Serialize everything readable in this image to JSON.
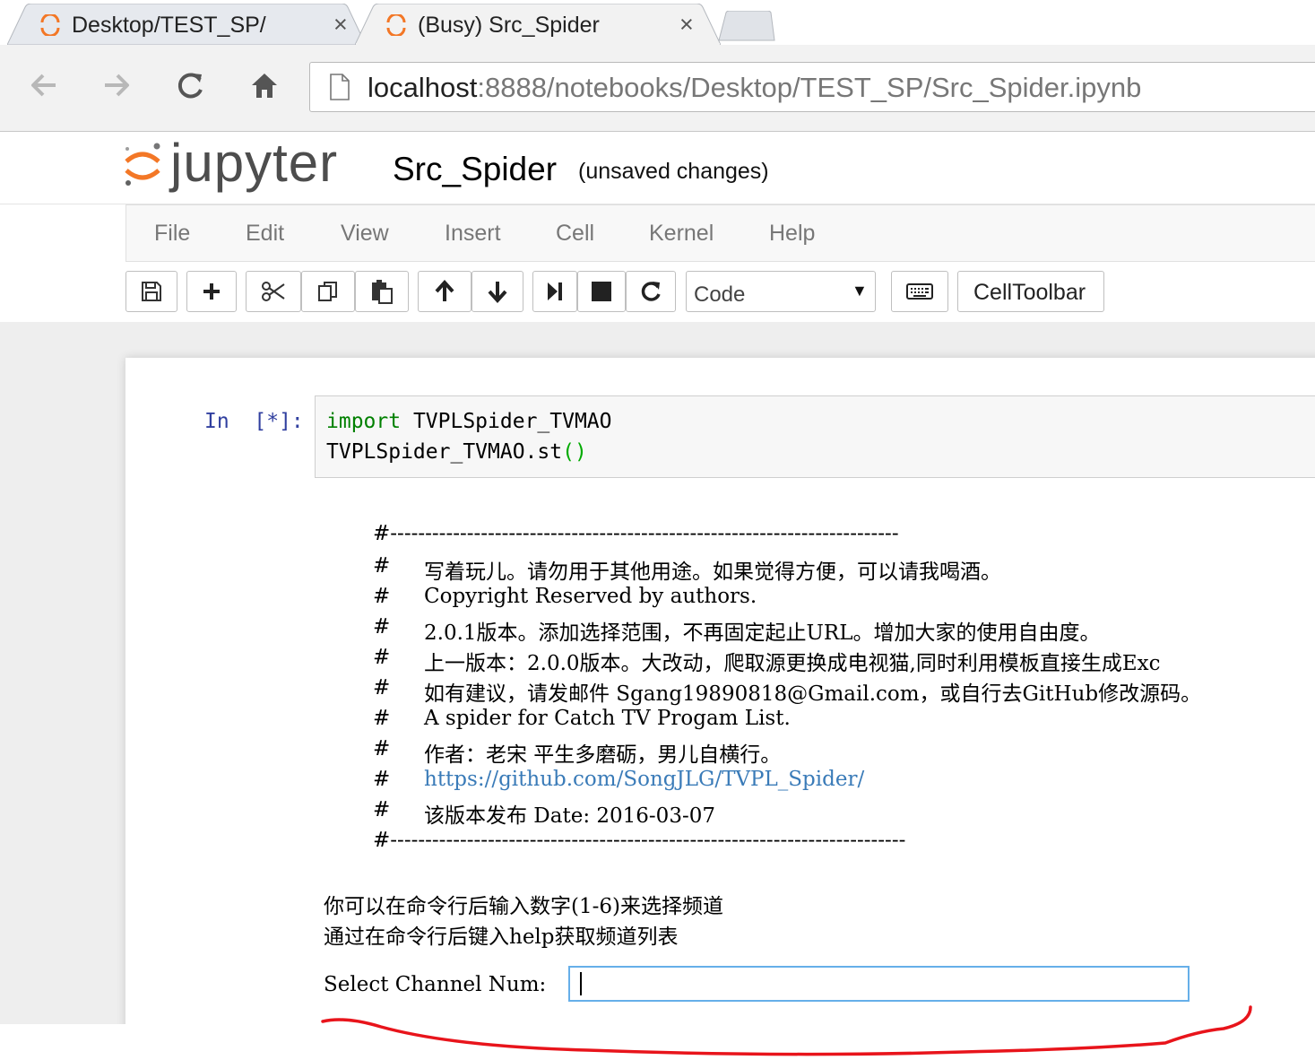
{
  "browser": {
    "tabs": [
      {
        "title": "Desktop/TEST_SP/",
        "close": "×",
        "active": false
      },
      {
        "title": "(Busy) Src_Spider",
        "close": "×",
        "active": true
      }
    ],
    "address": {
      "host": "localhost",
      "path": ":8888/notebooks/Desktop/TEST_SP/Src_Spider.ipynb"
    },
    "icons": [
      "back-icon",
      "forward-icon",
      "reload-icon",
      "home-icon",
      "page-icon"
    ]
  },
  "jupyter": {
    "logo_text": "jupyter",
    "notebook_name": "Src_Spider",
    "status": "(unsaved changes)",
    "menu": [
      "File",
      "Edit",
      "View",
      "Insert",
      "Cell",
      "Kernel",
      "Help"
    ],
    "toolbar": {
      "cell_type": "Code",
      "celltoolbar_label": "CellToolbar"
    },
    "accent_color": "#f37726"
  },
  "cell": {
    "prompt": "In  [*]:",
    "code_keyword": "import",
    "code_line1_rest": " TVPLSpider_TVMAO",
    "code_line2": "TVPLSpider_TVMAO.st",
    "code_line2_parens": "()"
  },
  "output": {
    "rule_top": "#-------------------------------------------------------------------------",
    "lines": [
      "写着玩儿。请勿用于其他用途。如果觉得方便，可以请我喝酒。",
      "Copyright Reserved by authors.",
      "2.0.1版本。添加选择范围，不再固定起止URL。增加大家的使用自由度。",
      "上一版本：2.0.0版本。大改动，爬取源更换成电视猫,同时利用模板直接生成Exc",
      "如有建议，请发邮件 Sgang19890818@Gmail.com，或自行去GitHub修改源码。",
      "A spider for Catch TV Progam List.",
      "作者：老宋 平生多磨砺，男儿自横行。",
      "https://github.com/SongJLG/TVPL_Spider/",
      "该版本发布 Date: 2016-03-07"
    ],
    "hash": "#",
    "rule_bottom": "#--------------------------------------------------------------------------",
    "hint1": "你可以在命令行后输入数字(1-6)来选择频道",
    "hint2": "通过在命令行后键入help获取频道列表",
    "input_label": "Select Channel Num:",
    "input_value": ""
  }
}
